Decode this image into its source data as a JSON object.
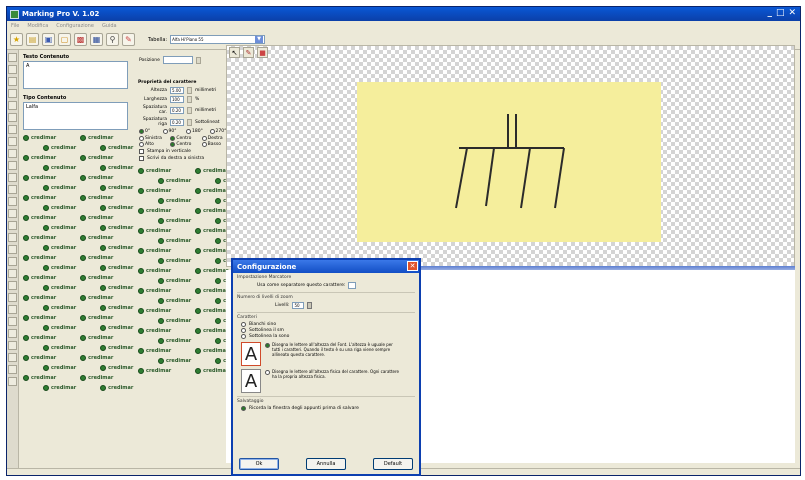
{
  "app": {
    "title": "Marking Pro V. 1.02"
  },
  "menu": [
    "File",
    "Modifica",
    "Configurazione",
    "Guida"
  ],
  "toolbar": {
    "icons": [
      "new-file-icon",
      "open-folder-icon",
      "save-icon",
      "print-icon",
      "preview-icon",
      "copy-icon",
      "zoom-icon",
      "marker-icon"
    ],
    "template_label": "Tabella:",
    "template_value": "Alfa Hi'Piano 55"
  },
  "left": {
    "items_group": "Testo Contenuto",
    "items_value": "A",
    "type_group": "Tipo Contenuto",
    "type_value": "Lalfa"
  },
  "logo_text": "credimar",
  "properties": {
    "pos_label": "Posizione",
    "heading": "Proprietà del carattere",
    "rows": [
      {
        "label": "Altezza",
        "value": "5.00",
        "unit": "millimetri"
      },
      {
        "label": "Larghezza",
        "value": "100",
        "unit": "%"
      },
      {
        "label": "Spaziatura car.",
        "value": "0.20",
        "unit": "millimetri"
      },
      {
        "label": "Spaziatura riga",
        "value": "0.20",
        "unit": "Sottolineat"
      }
    ],
    "rotation_options": [
      "0°",
      "90°",
      "180°",
      "270°"
    ],
    "align_options": [
      "Sinistra",
      "Centro",
      "Destra",
      "Alto",
      "Centro",
      "Basso"
    ],
    "checkbox_options": [
      "Stampa in verticale",
      "Scrivi da destra a sinistra"
    ]
  },
  "dialog": {
    "title": "Configurazione",
    "sep_section": "Impostazione Marcatore",
    "sep_label": "Usa come separatore questo carattere:",
    "levels_section": "Numero di livelli di zoom",
    "levels_label": "Livelli:",
    "levels_value": "50",
    "chars_section": "Caratteri",
    "chars_options": [
      "Bianchi sino",
      "Sottolinea il sm",
      "Sottolinea la sono"
    ],
    "char_opt1_text": "Disegna le lettere all'altezza del Font. L'altezza è uguale per tutti i caratteri. Quando il testo è su una riga viene sempre allineato questo carattere.",
    "char_opt2_text": "Disegna le lettere all'altezza fisica del carattere. Ogni carattere ha la propria altezza fisica.",
    "save_section": "Salvataggio",
    "save_option": "Ricorda la finestra degli appunti prima di salvare",
    "ok": "Ok",
    "cancel": "Annulla",
    "default": "Default"
  }
}
